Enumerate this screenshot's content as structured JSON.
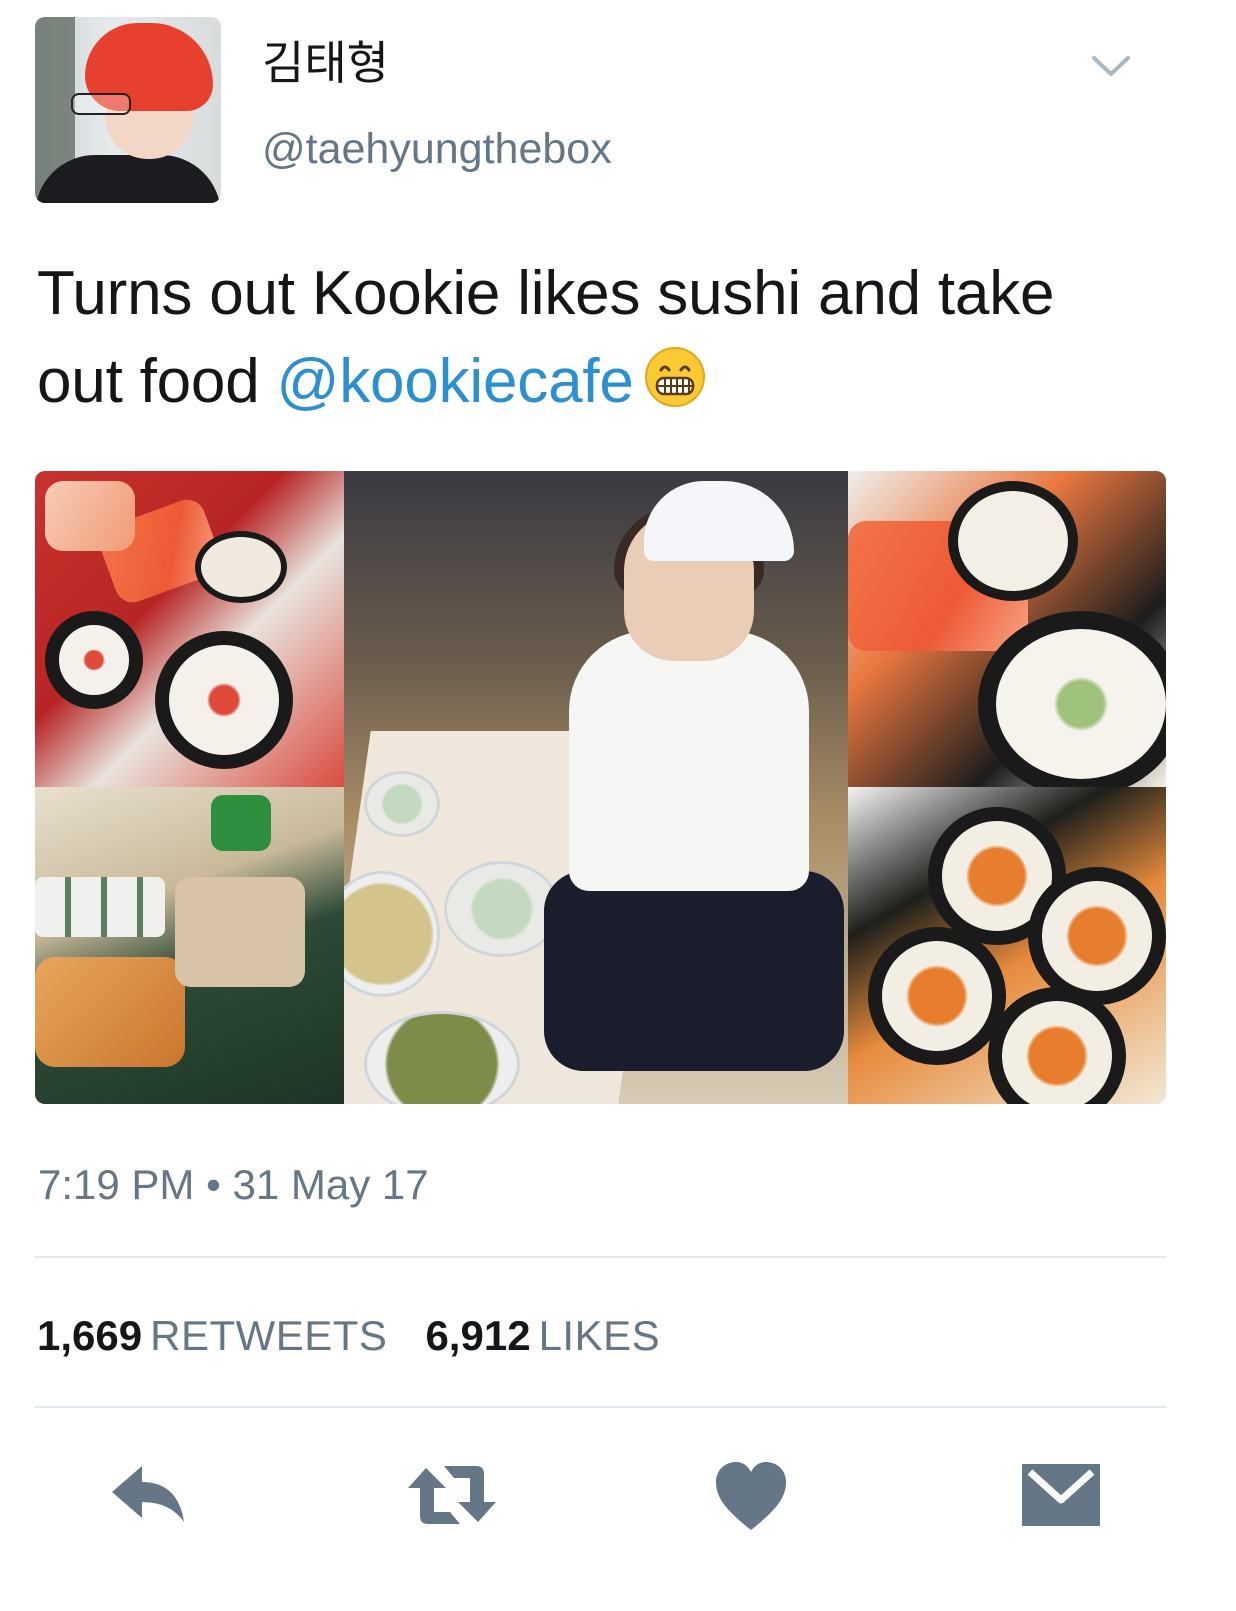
{
  "tweet": {
    "display_name": "김태형",
    "handle": "@taehyungthebox",
    "text_line1": "Turns out Kookie likes sushi and take",
    "text_line2_prefix": "out food ",
    "mention": "@kookiecafe",
    "emoji": "grimacing-face-emoji",
    "time": "7:19 PM",
    "separator": " • ",
    "date": "31 May 17",
    "retweets_count": "1,669",
    "retweets_label": "RETWEETS",
    "likes_count": "6,912",
    "likes_label": "LIKES"
  },
  "colors": {
    "link": "#2b8fd1",
    "secondary_text": "#657786",
    "icon": "#657786"
  },
  "icons": {
    "menu": "chevron-down-icon",
    "reply": "reply-icon",
    "retweet": "retweet-icon",
    "like": "heart-icon",
    "message": "envelope-icon"
  }
}
